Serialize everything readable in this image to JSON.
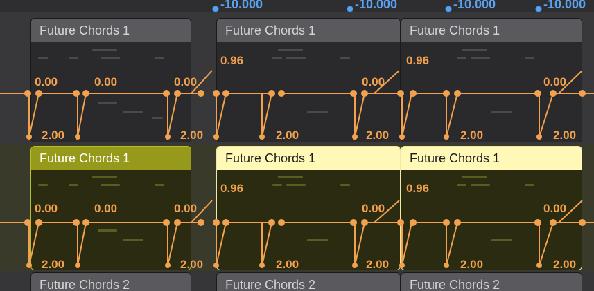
{
  "top_values": [
    "-10.000",
    "-10.000",
    "-10.000",
    "-10.000"
  ],
  "colors": {
    "automation": "#f2a24e",
    "top_value": "#5aa2ee",
    "selected_header": "#97991a",
    "highlight_header": "#fff8b6"
  },
  "tracks": [
    {
      "regions": [
        {
          "name": "Future Chords 1",
          "state": "normal",
          "peak": "",
          "labels": [
            "0.00",
            "0.00",
            "0.00"
          ],
          "bottom": [
            "2.00",
            "2.00"
          ]
        },
        {
          "name": "Future Chords 1",
          "state": "normal",
          "peak": "0.96",
          "labels": [
            "0.00"
          ],
          "bottom": [
            "2.00"
          ]
        },
        {
          "name": "Future Chords 1",
          "state": "normal",
          "peak": "0.96",
          "labels": [
            "0.00"
          ],
          "bottom": [
            "2.00",
            "2.00"
          ]
        }
      ]
    },
    {
      "regions": [
        {
          "name": "Future Chords 1",
          "state": "selected",
          "peak": "",
          "labels": [
            "0.00",
            "0.00",
            "0.00"
          ],
          "bottom": [
            "2.00",
            "2.00"
          ]
        },
        {
          "name": "Future Chords 1",
          "state": "highlighted",
          "peak": "0.96",
          "labels": [
            "0.00"
          ],
          "bottom": [
            "2.00",
            "2.00"
          ]
        },
        {
          "name": "Future Chords 1",
          "state": "highlighted",
          "peak": "0.96",
          "labels": [
            "0.00"
          ],
          "bottom": [
            "2.00",
            "2.00"
          ]
        }
      ]
    },
    {
      "regions": [
        {
          "name": "Future Chords 2",
          "state": "normal"
        },
        {
          "name": "Future Chords 2",
          "state": "normal"
        },
        {
          "name": "Future Chords 2",
          "state": "normal"
        }
      ]
    }
  ]
}
